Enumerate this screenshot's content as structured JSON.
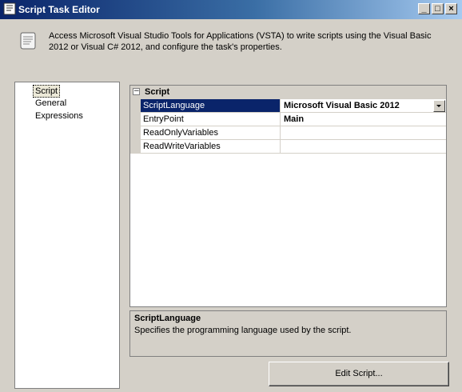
{
  "window": {
    "title": "Script Task Editor",
    "controls": {
      "minimize": "_",
      "maximize": "□",
      "close": "×"
    }
  },
  "header": {
    "description": "Access Microsoft Visual Studio Tools for Applications (VSTA) to write scripts using the Visual Basic 2012 or Visual C# 2012, and configure the task's properties.",
    "icon": "script-scroll-icon"
  },
  "nav": {
    "items": [
      {
        "label": "Script",
        "selected": true
      },
      {
        "label": "General",
        "selected": false
      },
      {
        "label": "Expressions",
        "selected": false
      }
    ]
  },
  "grid": {
    "category": {
      "label": "Script",
      "toggle": "−"
    },
    "properties": [
      {
        "name": "ScriptLanguage",
        "value": "Microsoft Visual Basic 2012",
        "selected": true,
        "has_dropdown": true
      },
      {
        "name": "EntryPoint",
        "value": "Main",
        "selected": false
      },
      {
        "name": "ReadOnlyVariables",
        "value": "",
        "selected": false
      },
      {
        "name": "ReadWriteVariables",
        "value": "",
        "selected": false
      }
    ]
  },
  "help": {
    "title": "ScriptLanguage",
    "text": "Specifies the programming language used by the script."
  },
  "buttons": {
    "edit_script": "Edit Script..."
  },
  "colors": {
    "titlebar": "#0a246a",
    "selection": "#0a246a",
    "face": "#d4d0c8"
  }
}
